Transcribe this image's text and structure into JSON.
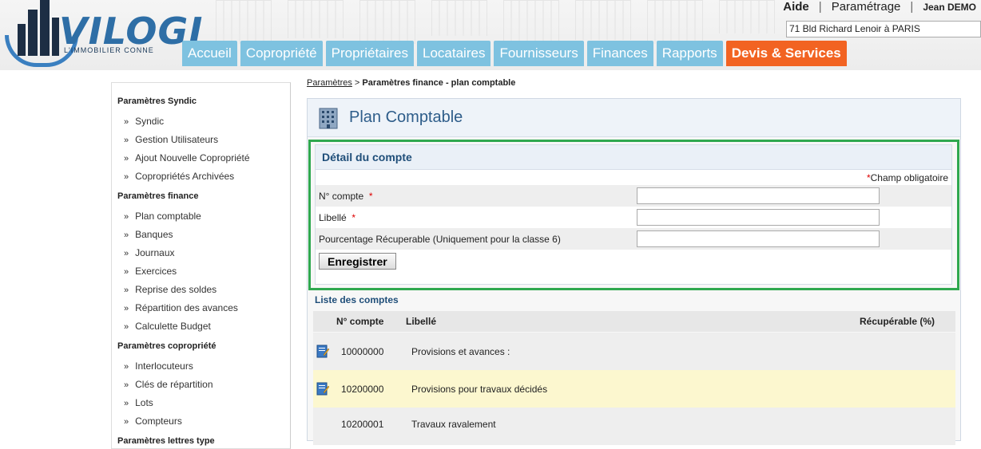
{
  "header": {
    "logo_text": "VILOGI",
    "logo_sub": "L'IMMOBILIER CONNE",
    "aide": "Aide",
    "sep1": "|",
    "parametrage": "Paramétrage",
    "sep2": "|",
    "user": "Jean DEMO",
    "address": "71 Bld Richard Lenoir à PARIS"
  },
  "nav": [
    "Accueil",
    "Copropriété",
    "Propriétaires",
    "Locataires",
    "Fournisseurs",
    "Finances",
    "Rapports",
    "Devis & Services"
  ],
  "sidebar": {
    "syndic_head": "Paramètres Syndic",
    "syndic": [
      "Syndic",
      "Gestion Utilisateurs",
      "Ajout Nouvelle Copropriété",
      "Copropriétés Archivées"
    ],
    "finance_head": "Paramètres finance",
    "finance": [
      "Plan comptable",
      "Banques",
      "Journaux",
      "Exercices",
      "Reprise des soldes",
      "Répartition des avances",
      "Calculette Budget"
    ],
    "copro_head": "Paramètres copropriété",
    "copro": [
      "Interlocuteurs",
      "Clés de répartition",
      "Lots",
      "Compteurs"
    ],
    "lettres_head": "Paramètres lettres type",
    "arrow": "»"
  },
  "breadcrumb": {
    "link": "Paramètres",
    "sep": " > ",
    "current": "Paramètres finance - plan comptable"
  },
  "panel": {
    "title": "Plan Comptable"
  },
  "detail": {
    "heading": "Détail du compte",
    "required_mark": "*",
    "required_note": "Champ obligatoire",
    "fields": [
      {
        "label": "N° compte",
        "required": "*"
      },
      {
        "label": "Libellé",
        "required": "*"
      },
      {
        "label": "Pourcentage Récuperable (Uniquement pour la classe 6)",
        "required": ""
      }
    ],
    "save": "Enregistrer"
  },
  "list": {
    "title": "Liste des comptes",
    "headers": {
      "num": "N° compte",
      "libelle": "Libellé",
      "recup": "Récupérable (%)"
    },
    "rows": [
      {
        "num": "10000000",
        "libelle": "Provisions et avances :"
      },
      {
        "num": "10200000",
        "libelle": "Provisions pour travaux décidés"
      },
      {
        "num": "10200001",
        "libelle": "Travaux ravalement"
      }
    ]
  },
  "colors": {
    "nav_tab": "#7ec2e0",
    "nav_active": "#f26322",
    "highlight_row": "#fcf7cf",
    "frame_green": "#2fa84f",
    "title_blue": "#2e5d8a"
  }
}
